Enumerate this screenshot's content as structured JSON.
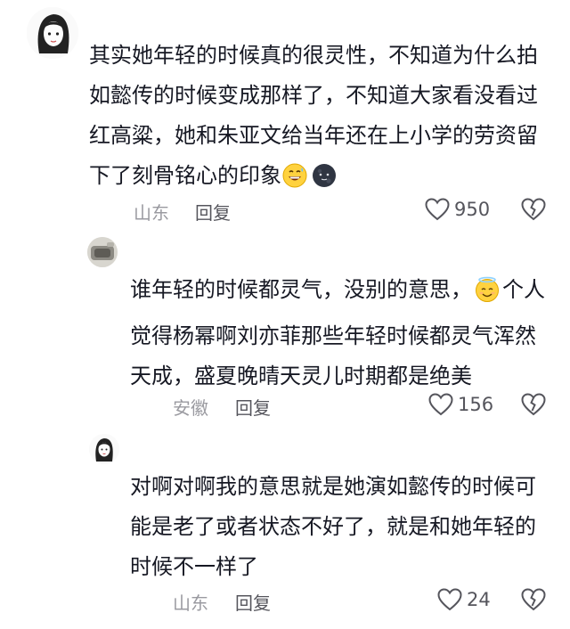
{
  "comments": [
    {
      "username": "",
      "text": "其实她年轻的时候真的很灵性，不知道为什么拍如懿传的时候变成那样了，不知道大家看没看过红高粱，她和朱亚文给当年还在上小学的劳资留下了刻骨铭心的印象",
      "emojis": [
        "grinning-face-sweat",
        "new-moon-face"
      ],
      "location": "山东",
      "reply_label": "回复",
      "likes": "950"
    },
    {
      "username": "",
      "text_before_emoji": "谁年轻的时候都灵气，没别的意思，",
      "emoji": "smiling-face-halo",
      "text_after_emoji": "个人觉得杨幂啊刘亦菲那些年轻时候都灵气浑然天成，盛夏晚晴天灵儿时期都是绝美",
      "location": "安徽",
      "reply_label": "回复",
      "likes": "156"
    },
    {
      "username": "",
      "text": "对啊对啊我的意思就是她演如懿传的时候可能是老了或者状态不好了，就是和她年轻的时候不一样了",
      "location": "山东",
      "reply_label": "回复",
      "likes": "24"
    }
  ],
  "icons": {
    "like": "heart-outline-icon",
    "dislike": "broken-heart-icon"
  }
}
